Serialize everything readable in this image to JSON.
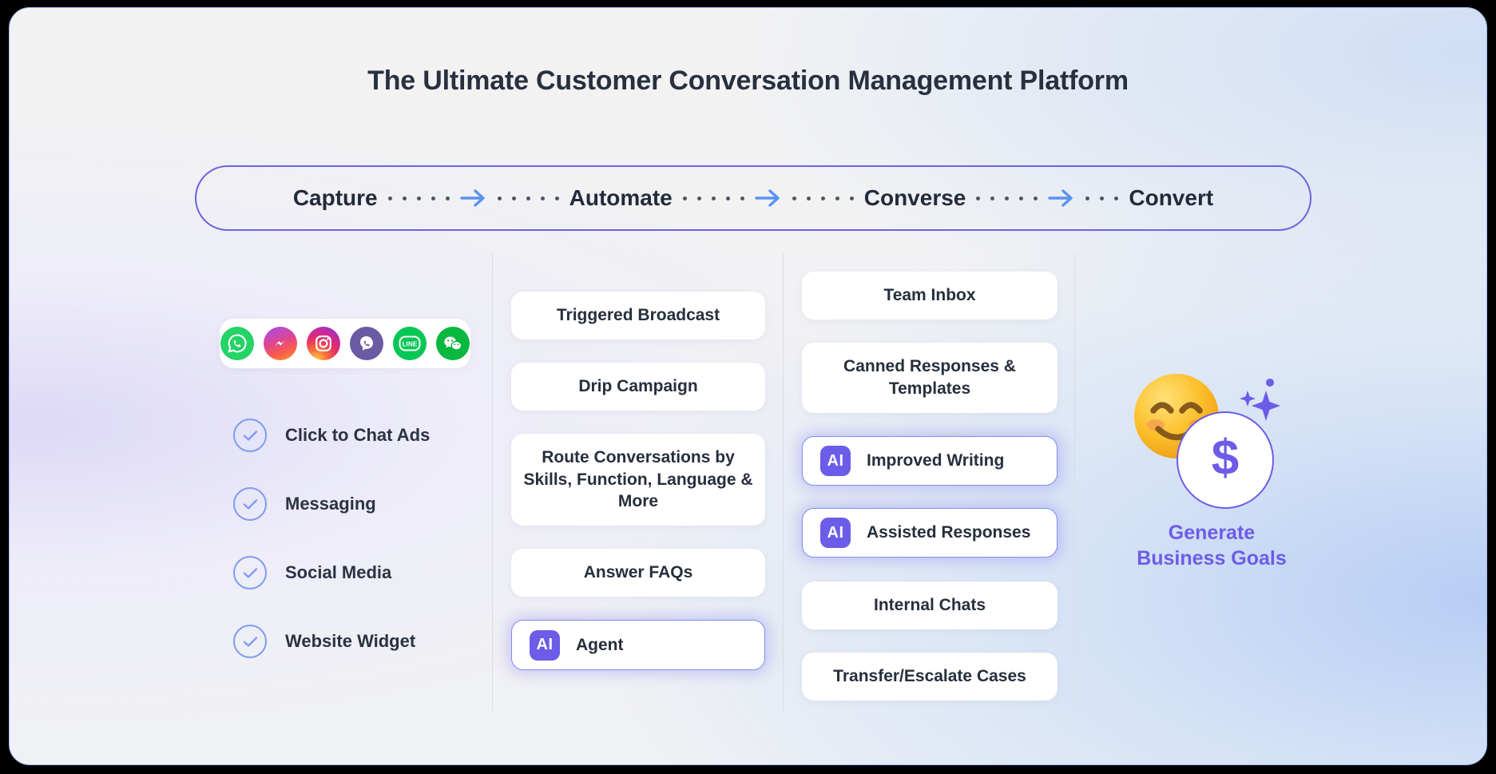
{
  "title": "The Ultimate Customer Conversation Management Platform",
  "colors": {
    "accent_purple": "#6c5ce7",
    "arrow_blue": "#5a93ef",
    "check_blue": "#7f9cf0",
    "text_dark": "#262f3d",
    "card_bg": "#ffffff"
  },
  "stepper": {
    "steps": [
      "Capture",
      "Automate",
      "Converse",
      "Convert"
    ],
    "separators": [
      {
        "dots_before": 5,
        "icon": "arrow-right-icon",
        "dots_after": 5
      },
      {
        "dots_before": 5,
        "icon": "arrow-right-icon",
        "dots_after": 5
      },
      {
        "dots_before": 5,
        "icon": "arrow-right-icon",
        "dots_after": 3
      }
    ]
  },
  "capture": {
    "channels": [
      {
        "name": "whatsapp-icon",
        "label": "WhatsApp"
      },
      {
        "name": "messenger-icon",
        "label": "Messenger"
      },
      {
        "name": "instagram-icon",
        "label": "Instagram"
      },
      {
        "name": "viber-icon",
        "label": "Viber"
      },
      {
        "name": "line-icon",
        "label": "LINE"
      },
      {
        "name": "wechat-icon",
        "label": "WeChat"
      }
    ],
    "items": [
      {
        "label": "Click to Chat Ads"
      },
      {
        "label": "Messaging"
      },
      {
        "label": "Social Media"
      },
      {
        "label": "Website Widget"
      }
    ]
  },
  "automate": {
    "cards": [
      {
        "label": "Triggered Broadcast",
        "ai": false
      },
      {
        "label": "Drip Campaign",
        "ai": false
      },
      {
        "label": "Route Conversations by Skills, Function, Language & More",
        "ai": false
      },
      {
        "label": "Answer FAQs",
        "ai": false
      },
      {
        "label": "Agent",
        "ai": true,
        "badge": "AI"
      }
    ]
  },
  "converse": {
    "cards": [
      {
        "label": "Team Inbox",
        "ai": false
      },
      {
        "label": "Canned Responses & Templates",
        "ai": false
      },
      {
        "label": "Improved Writing",
        "ai": true,
        "badge": "AI"
      },
      {
        "label": "Assisted Responses",
        "ai": true,
        "badge": "AI"
      },
      {
        "label": "Internal Chats",
        "ai": false
      },
      {
        "label": "Transfer/Escalate Cases",
        "ai": false
      }
    ]
  },
  "convert": {
    "emoji": "smiling-face-with-smiling-eyes",
    "currency_symbol": "$",
    "label_line1": "Generate",
    "label_line2": "Business Goals"
  }
}
